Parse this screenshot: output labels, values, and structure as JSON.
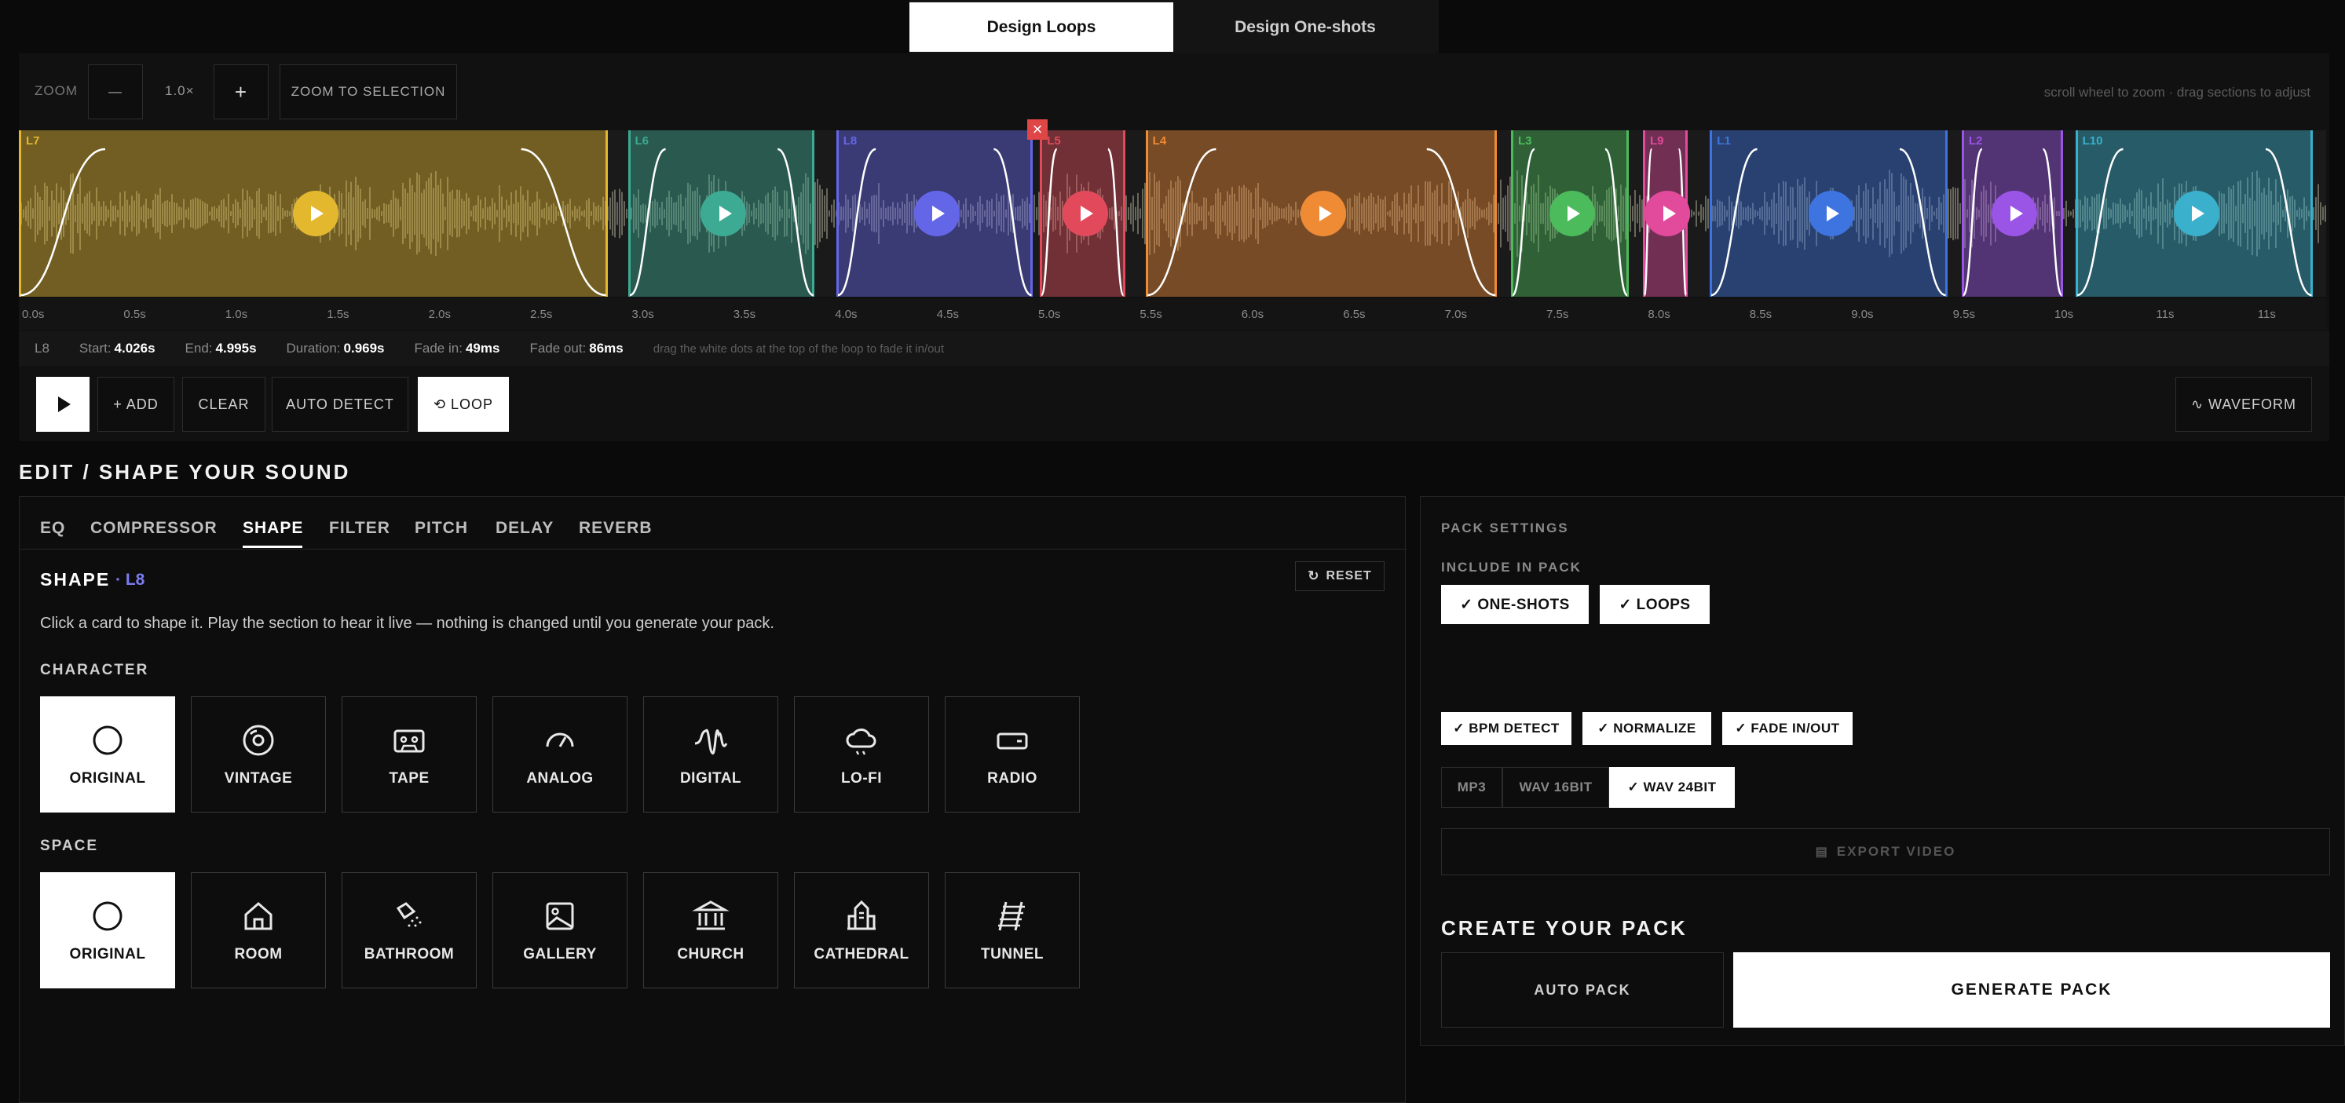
{
  "top_tabs": [
    {
      "label": "Design Loops",
      "active": true
    },
    {
      "label": "Design One-shots",
      "active": false
    }
  ],
  "zoom": {
    "label": "ZOOM",
    "minus": "—",
    "level": "1.0×",
    "plus": "+",
    "to_selection": "ZOOM TO SELECTION",
    "hint": "scroll wheel to zoom · drag sections to adjust"
  },
  "loops": [
    {
      "id": "L7",
      "color": "#e3b72e",
      "start": 0.0,
      "end": 2.9
    },
    {
      "id": "L6",
      "color": "#3dab94",
      "start": 3.0,
      "end": 3.92
    },
    {
      "id": "L8",
      "color": "#6466e8",
      "start": 4.026,
      "end": 4.995
    },
    {
      "id": "L5",
      "color": "#e24a5c",
      "start": 5.03,
      "end": 5.45
    },
    {
      "id": "L4",
      "color": "#ef8a35",
      "start": 5.55,
      "end": 7.28
    },
    {
      "id": "L3",
      "color": "#4cbb5c",
      "start": 7.35,
      "end": 7.93
    },
    {
      "id": "L9",
      "color": "#e24a9c",
      "start": 8.0,
      "end": 8.22
    },
    {
      "id": "L1",
      "color": "#3d74e0",
      "start": 8.33,
      "end": 9.5
    },
    {
      "id": "L2",
      "color": "#9a55e6",
      "start": 9.57,
      "end": 10.07
    },
    {
      "id": "L10",
      "color": "#3ab0cc",
      "start": 10.13,
      "end": 11.3
    }
  ],
  "ruler": [
    "0.0s",
    "0.5s",
    "1.0s",
    "1.5s",
    "2.0s",
    "2.5s",
    "3.0s",
    "3.5s",
    "4.0s",
    "4.5s",
    "5.0s",
    "5.5s",
    "6.0s",
    "6.5s",
    "7.0s",
    "7.5s",
    "8.0s",
    "8.5s",
    "9.0s",
    "9.5s",
    "10s",
    "11s",
    "11s"
  ],
  "selection": {
    "loop": "L8",
    "start_label": "Start:",
    "start": "4.026s",
    "end_label": "End:",
    "end": "4.995s",
    "duration_label": "Duration:",
    "duration": "0.969s",
    "fade_in_label": "Fade in:",
    "fade_in": "49ms",
    "fade_out_label": "Fade out:",
    "fade_out": "86ms",
    "hint": "drag the white dots at the top of the loop to fade it in/out"
  },
  "transport": {
    "add": "+ ADD",
    "clear": "CLEAR",
    "auto_detect": "AUTO DETECT",
    "loop": "⟲ LOOP",
    "waveform": "∿ WAVEFORM"
  },
  "edit_title": "EDIT / SHAPE YOUR SOUND",
  "fx_tabs": [
    "EQ",
    "COMPRESSOR",
    "SHAPE",
    "FILTER",
    "PITCH",
    "DELAY",
    "REVERB"
  ],
  "shape": {
    "title": "SHAPE",
    "loop_tag": "· L8",
    "reset": "RESET",
    "description": "Click a card to shape it. Play the section to hear it live — nothing is changed until you generate your pack.",
    "character_label": "CHARACTER",
    "character": [
      {
        "label": "ORIGINAL",
        "icon": "circle-icon",
        "selected": true
      },
      {
        "label": "VINTAGE",
        "icon": "vinyl-icon",
        "selected": false
      },
      {
        "label": "TAPE",
        "icon": "cassette-icon",
        "selected": false
      },
      {
        "label": "ANALOG",
        "icon": "gauge-icon",
        "selected": false
      },
      {
        "label": "DIGITAL",
        "icon": "audio-wave-icon",
        "selected": false
      },
      {
        "label": "LO-FI",
        "icon": "cloud-icon",
        "selected": false
      },
      {
        "label": "RADIO",
        "icon": "radio-icon",
        "selected": false
      }
    ],
    "space_label": "SPACE",
    "space": [
      {
        "label": "ORIGINAL",
        "icon": "circle-icon",
        "selected": true
      },
      {
        "label": "ROOM",
        "icon": "house-icon",
        "selected": false
      },
      {
        "label": "BATHROOM",
        "icon": "shower-icon",
        "selected": false
      },
      {
        "label": "GALLERY",
        "icon": "image-icon",
        "selected": false
      },
      {
        "label": "CHURCH",
        "icon": "landmark-icon",
        "selected": false
      },
      {
        "label": "CATHEDRAL",
        "icon": "cathedral-icon",
        "selected": false
      },
      {
        "label": "TUNNEL",
        "icon": "rail-track-icon",
        "selected": false
      }
    ]
  },
  "pack": {
    "settings_label": "PACK SETTINGS",
    "include_label": "INCLUDE IN PACK",
    "include_oneshots": "✓  ONE-SHOTS",
    "include_loops": "✓  LOOPS",
    "bpm_detect": "✓ BPM DETECT",
    "normalize": "✓ NORMALIZE",
    "fade": "✓ FADE IN/OUT",
    "formats": [
      {
        "label": "MP3",
        "selected": false
      },
      {
        "label": "WAV 16BIT",
        "selected": false
      },
      {
        "label": "✓ WAV 24BIT",
        "selected": true
      }
    ],
    "export_video": "EXPORT VIDEO",
    "create_title": "CREATE YOUR PACK",
    "auto_pack": "AUTO PACK",
    "generate": "GENERATE PACK"
  }
}
